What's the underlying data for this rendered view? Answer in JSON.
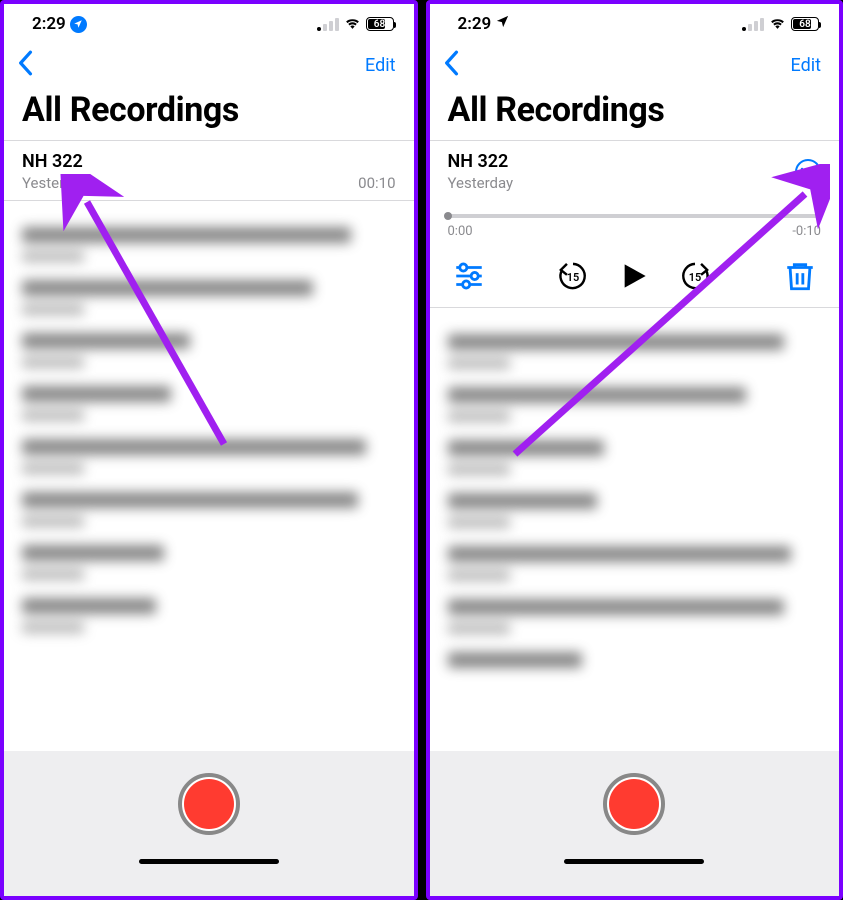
{
  "status": {
    "time": "2:29",
    "battery": "68"
  },
  "nav": {
    "edit": "Edit",
    "title": "All Recordings"
  },
  "recording": {
    "title": "NH 322",
    "subtitle": "Yesterday",
    "duration": "00:10"
  },
  "scrubber": {
    "current": "0:00",
    "remaining": "-0:10"
  }
}
